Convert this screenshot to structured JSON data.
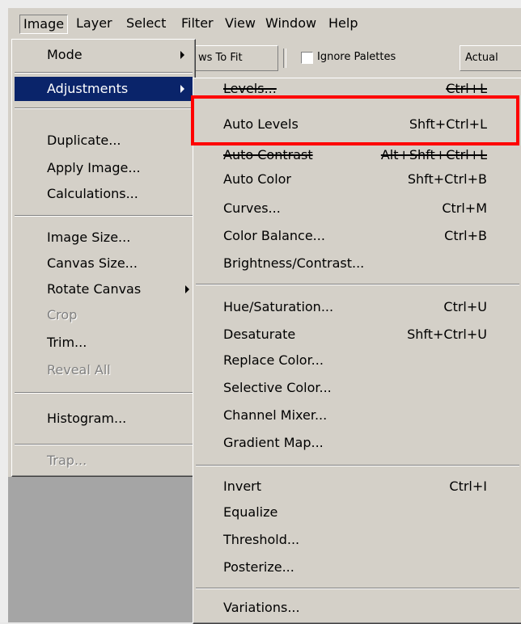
{
  "menubar": {
    "items": [
      "Image",
      "Layer",
      "Select",
      "Filter",
      "View",
      "Window",
      "Help"
    ]
  },
  "options_bar": {
    "fit_button_partial": "ws To Fit",
    "ignore_palettes_label": "Ignore Palettes",
    "actual_button_partial": "Actual"
  },
  "image_menu": {
    "items": [
      {
        "label": "Mode",
        "submenu": true
      },
      {
        "label": "Adjustments",
        "submenu": true,
        "highlighted": true
      },
      {
        "label": "Duplicate..."
      },
      {
        "label": "Apply Image..."
      },
      {
        "label": "Calculations..."
      },
      {
        "label": "Image Size..."
      },
      {
        "label": "Canvas Size..."
      },
      {
        "label": "Rotate Canvas",
        "submenu": true
      },
      {
        "label": "Crop",
        "disabled": true
      },
      {
        "label": "Trim..."
      },
      {
        "label": "Reveal All",
        "disabled": true
      },
      {
        "label": "Histogram..."
      },
      {
        "label": "Trap...",
        "disabled": true
      }
    ]
  },
  "adjustments_menu": {
    "items": [
      {
        "label": "Levels...",
        "shortcut": "Ctrl+L"
      },
      {
        "label": "Auto Levels",
        "shortcut": "Shft+Ctrl+L"
      },
      {
        "label": "Auto Contrast",
        "shortcut": "Alt+Shft+Ctrl+L"
      },
      {
        "label": "Auto Color",
        "shortcut": "Shft+Ctrl+B"
      },
      {
        "label": "Curves...",
        "shortcut": "Ctrl+M"
      },
      {
        "label": "Color Balance...",
        "shortcut": "Ctrl+B"
      },
      {
        "label": "Brightness/Contrast...",
        "shortcut": ""
      },
      {
        "label": "Hue/Saturation...",
        "shortcut": "Ctrl+U"
      },
      {
        "label": "Desaturate",
        "shortcut": "Shft+Ctrl+U"
      },
      {
        "label": "Replace Color...",
        "shortcut": ""
      },
      {
        "label": "Selective Color...",
        "shortcut": ""
      },
      {
        "label": "Channel Mixer...",
        "shortcut": ""
      },
      {
        "label": "Gradient Map...",
        "shortcut": ""
      },
      {
        "label": "Invert",
        "shortcut": "Ctrl+I"
      },
      {
        "label": "Equalize",
        "shortcut": ""
      },
      {
        "label": "Threshold...",
        "shortcut": ""
      },
      {
        "label": "Posterize...",
        "shortcut": ""
      },
      {
        "label": "Variations...",
        "shortcut": ""
      }
    ]
  },
  "colors": {
    "menu_bg": "#d4d0c8",
    "highlight": "#0a246a",
    "annotation_box": "#ff0000"
  }
}
